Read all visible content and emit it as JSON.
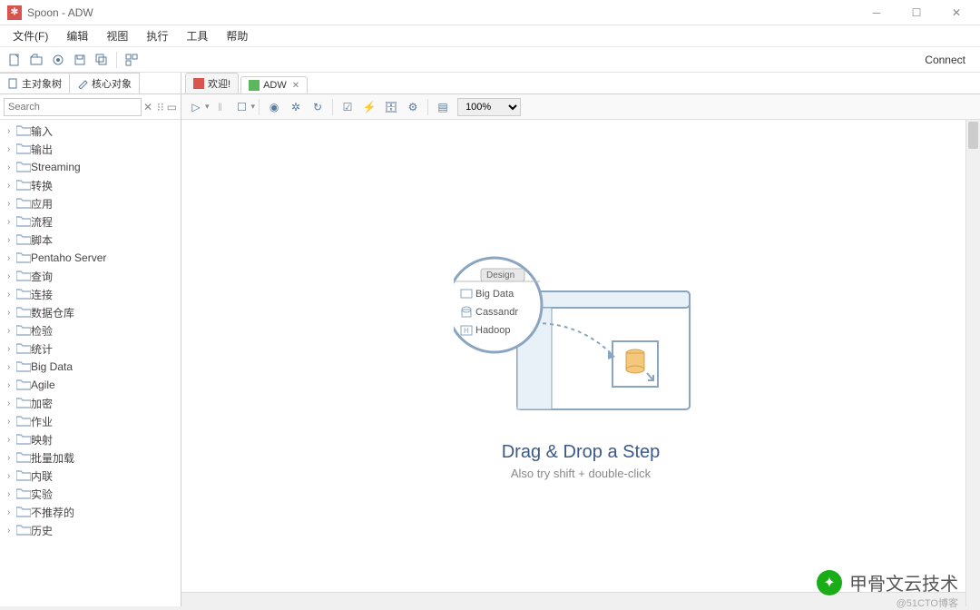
{
  "window": {
    "title": "Spoon - ADW"
  },
  "menu": {
    "items": [
      "文件(F)",
      "编辑",
      "视图",
      "执行",
      "工具",
      "帮助"
    ]
  },
  "toolbar": {
    "connect": "Connect"
  },
  "sidebar": {
    "tabs": [
      {
        "label": "主对象树",
        "icon": "doc"
      },
      {
        "label": "核心对象",
        "icon": "pencil"
      }
    ],
    "search": {
      "placeholder": "Search"
    },
    "tree": [
      {
        "label": "输入"
      },
      {
        "label": "输出"
      },
      {
        "label": "Streaming"
      },
      {
        "label": "转换"
      },
      {
        "label": "应用"
      },
      {
        "label": "流程"
      },
      {
        "label": "脚本"
      },
      {
        "label": "Pentaho Server"
      },
      {
        "label": "查询"
      },
      {
        "label": "连接"
      },
      {
        "label": "数据仓库"
      },
      {
        "label": "检验"
      },
      {
        "label": "统计"
      },
      {
        "label": "Big Data"
      },
      {
        "label": "Agile"
      },
      {
        "label": "加密"
      },
      {
        "label": "作业"
      },
      {
        "label": "映射"
      },
      {
        "label": "批量加载"
      },
      {
        "label": "内联"
      },
      {
        "label": "实验"
      },
      {
        "label": "不推荐的"
      },
      {
        "label": "历史"
      }
    ]
  },
  "editor": {
    "tabs": [
      {
        "label": "欢迎!",
        "icon": "red"
      },
      {
        "label": "ADW",
        "icon": "green",
        "active": true
      }
    ],
    "zoom": "100%"
  },
  "illustration": {
    "design_tab": "Design",
    "items": [
      "Big Data",
      "Cassandr",
      "Hadoop"
    ],
    "title": "Drag & Drop a Step",
    "subtitle": "Also try shift + double-click"
  },
  "watermark": {
    "text": "甲骨文云技术",
    "sub": "@51CTO博客"
  }
}
